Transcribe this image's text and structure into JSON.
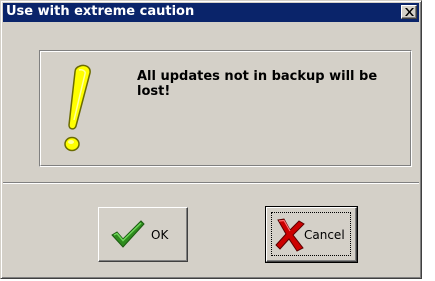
{
  "window": {
    "title": "Use with extreme caution",
    "close_icon": "close-x-icon"
  },
  "message": {
    "icon": "exclamation-icon",
    "text": "All updates not in backup will be lost!"
  },
  "buttons": {
    "ok": {
      "label": "OK",
      "icon": "checkmark-icon"
    },
    "cancel": {
      "label": "Cancel",
      "icon": "red-x-icon"
    }
  },
  "colors": {
    "titlebar": "#0a246a",
    "face": "#d4d0c8",
    "exclamation": "#ffff00",
    "checkmark": "#2e8b1e",
    "cancel_x": "#cc0000"
  }
}
